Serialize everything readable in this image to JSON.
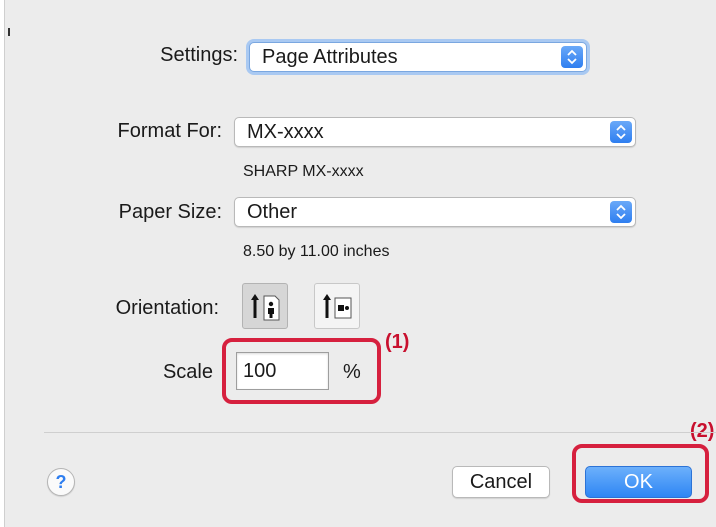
{
  "settings": {
    "label": "Settings:",
    "value": "Page Attributes"
  },
  "format_for": {
    "label": "Format For:",
    "value": "MX-xxxx",
    "description": "SHARP MX-xxxx"
  },
  "paper_size": {
    "label": "Paper Size:",
    "value": "Other",
    "dimensions": "8.50 by 11.00 inches"
  },
  "orientation": {
    "label": "Orientation:",
    "options": [
      "portrait",
      "landscape"
    ],
    "selected": "portrait"
  },
  "scale": {
    "label": "Scale",
    "value": "100",
    "unit": "%"
  },
  "annotations": {
    "callout_1": "(1)",
    "callout_2": "(2)",
    "highlight_color": "#d6203e"
  },
  "buttons": {
    "help": "?",
    "cancel": "Cancel",
    "ok": "OK"
  },
  "colors": {
    "accent": "#2e7ef0",
    "panel_bg": "#ececec"
  }
}
